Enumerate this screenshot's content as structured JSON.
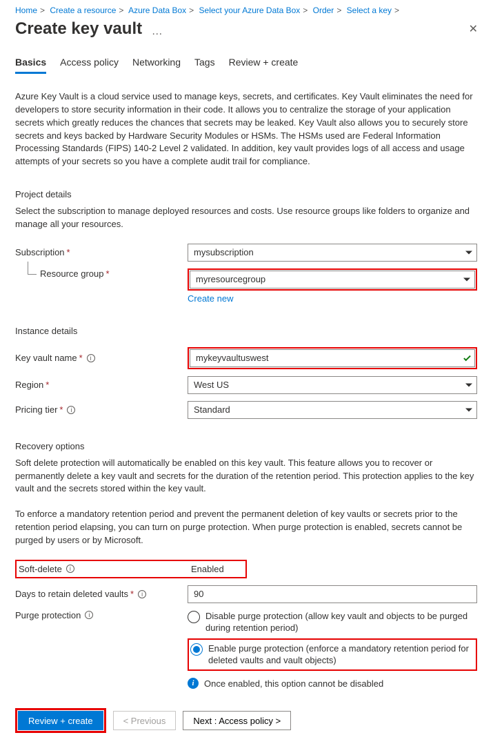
{
  "breadcrumb": [
    "Home",
    "Create a resource",
    "Azure Data Box",
    "Select your Azure Data Box",
    "Order",
    "Select a key"
  ],
  "title": "Create key vault",
  "tabs": [
    "Basics",
    "Access policy",
    "Networking",
    "Tags",
    "Review + create"
  ],
  "intro": "Azure Key Vault is a cloud service used to manage keys, secrets, and certificates. Key Vault eliminates the need for developers to store security information in their code. It allows you to centralize the storage of your application secrets which greatly reduces the chances that secrets may be leaked. Key Vault also allows you to securely store secrets and keys backed by Hardware Security Modules or HSMs. The HSMs used are Federal Information Processing Standards (FIPS) 140-2 Level 2 validated. In addition, key vault provides logs of all access and usage attempts of your secrets so you have a complete audit trail for compliance.",
  "project": {
    "title": "Project details",
    "desc": "Select the subscription to manage deployed resources and costs. Use resource groups like folders to organize and manage all your resources.",
    "subscription_label": "Subscription",
    "subscription_value": "mysubscription",
    "rg_label": "Resource group",
    "rg_value": "myresourcegroup",
    "create_new": "Create new"
  },
  "instance": {
    "title": "Instance details",
    "name_label": "Key vault name",
    "name_value": "mykeyvaultuswest",
    "region_label": "Region",
    "region_value": "West US",
    "tier_label": "Pricing tier",
    "tier_value": "Standard"
  },
  "recovery": {
    "title": "Recovery options",
    "desc1": "Soft delete protection will automatically be enabled on this key vault. This feature allows you to recover or permanently delete a key vault and secrets for the duration of the retention period. This protection applies to the key vault and the secrets stored within the key vault.",
    "desc2": "To enforce a mandatory retention period and prevent the permanent deletion of key vaults or secrets prior to the retention period elapsing, you can turn on purge protection. When purge protection is enabled, secrets cannot be purged by users or by Microsoft.",
    "soft_delete_label": "Soft-delete",
    "soft_delete_value": "Enabled",
    "days_label": "Days to retain deleted vaults",
    "days_value": "90",
    "purge_label": "Purge protection",
    "purge_opt1": "Disable purge protection (allow key vault and objects to be purged during retention period)",
    "purge_opt2": "Enable purge protection (enforce a mandatory retention period for deleted vaults and vault objects)",
    "purge_note": "Once enabled, this option cannot be disabled"
  },
  "footer": {
    "review": "Review + create",
    "prev": "< Previous",
    "next": "Next : Access policy >"
  }
}
